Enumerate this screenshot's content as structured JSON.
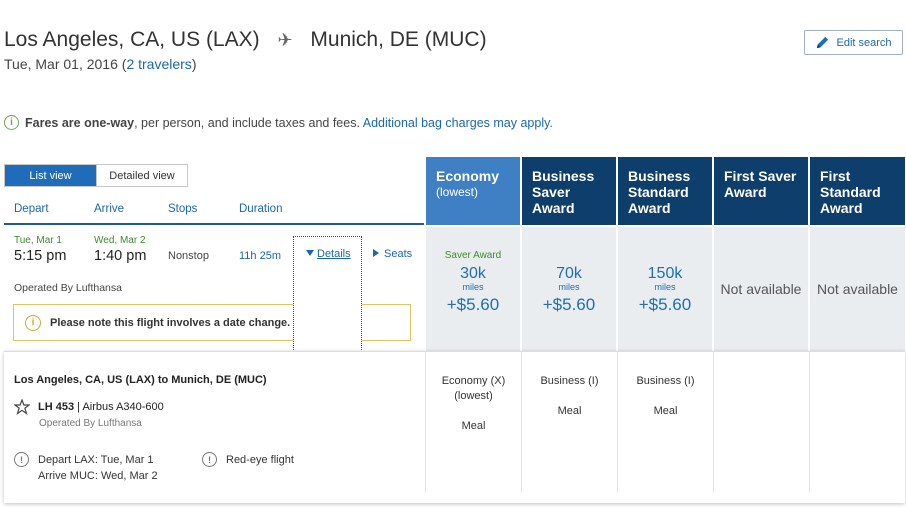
{
  "header": {
    "origin": "Los Angeles, CA, US (LAX)",
    "destination": "Munich, DE (MUC)",
    "date": "Tue, Mar 01, 2016",
    "travelers": "2 travelers",
    "edit_label": "Edit search"
  },
  "info": {
    "bold": "Fares are one-way",
    "text": ", per person, and include taxes and fees.",
    "link": "Additional bag charges may apply."
  },
  "view_toggle": {
    "list": "List view",
    "detailed": "Detailed view"
  },
  "columns": {
    "depart": "Depart",
    "arrive": "Arrive",
    "stops": "Stops",
    "duration": "Duration"
  },
  "fare_headers": [
    {
      "title": "Economy",
      "sub": "(lowest)"
    },
    {
      "title": "Business Saver Award"
    },
    {
      "title": "Business Standard Award"
    },
    {
      "title": "First Saver Award"
    },
    {
      "title": "First Standard Award"
    }
  ],
  "flight": {
    "depart_date": "Tue, Mar 1",
    "depart_time": "5:15 pm",
    "arrive_date": "Wed, Mar 2",
    "arrive_time": "1:40 pm",
    "stops": "Nonstop",
    "duration": "11h 25m",
    "details_label": "Details",
    "seats_label": "Seats",
    "operated_by": "Operated By Lufthansa",
    "date_change_note": "Please note this flight involves a date change."
  },
  "fares": [
    {
      "label": "Saver Award",
      "miles": "30k",
      "unit": "miles",
      "tax": "+$5.60"
    },
    {
      "miles": "70k",
      "unit": "miles",
      "tax": "+$5.60"
    },
    {
      "miles": "150k",
      "unit": "miles",
      "tax": "+$5.60"
    },
    {
      "text": "Not available"
    },
    {
      "text": "Not available"
    }
  ],
  "details_panel": {
    "route": "Los Angeles, CA, US (LAX) to Munich, DE (MUC)",
    "flight_no": "LH 453",
    "aircraft": "| Airbus A340-600",
    "operated_by": "Operated By Lufthansa",
    "depart_line": "Depart LAX: Tue, Mar 1",
    "arrive_line": "Arrive MUC: Wed, Mar 2",
    "redeye": "Red-eye flight",
    "cabins": [
      {
        "cabin": "Economy (X)",
        "sub": "(lowest)",
        "meal": "Meal"
      },
      {
        "cabin": "Business (I)",
        "meal": "Meal"
      },
      {
        "cabin": "Business (I)",
        "meal": "Meal"
      }
    ]
  },
  "colors": {
    "primary_blue": "#1f6cb8",
    "dark_navy": "#0e3e6b",
    "economy_blue": "#3f80c4",
    "green": "#3d8a2f",
    "warning": "#d4a62e"
  }
}
